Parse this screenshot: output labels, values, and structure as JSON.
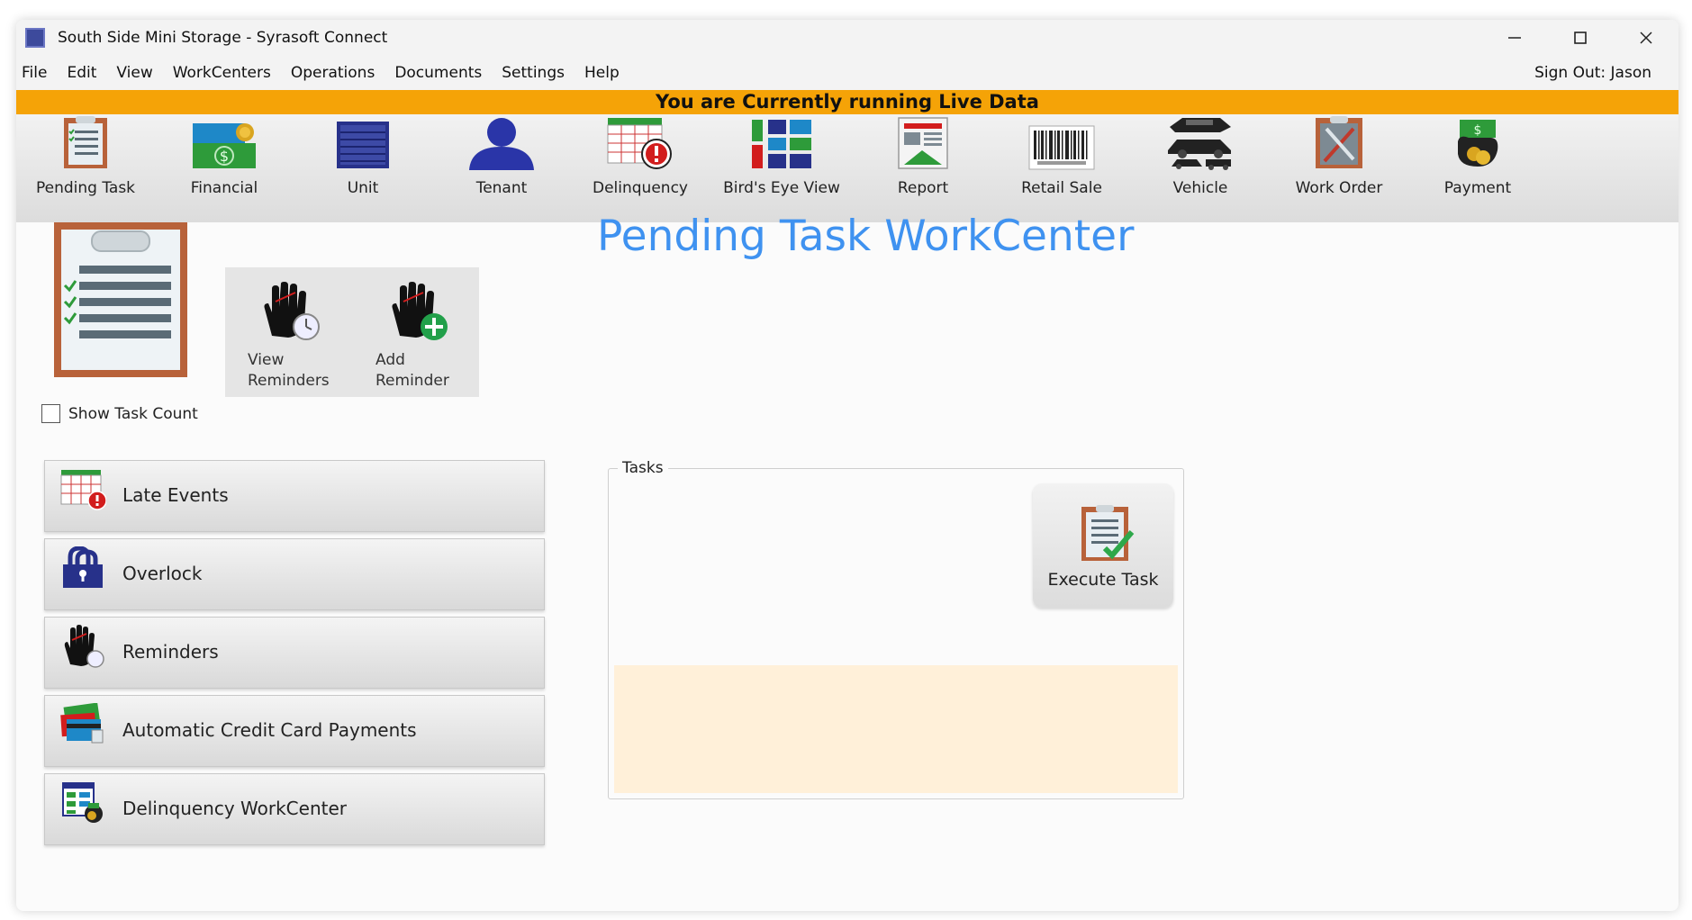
{
  "window": {
    "title": "South Side Mini Storage - Syrasoft Connect",
    "controls": {
      "minimize": "—",
      "maximize": "☐",
      "close": "✕"
    }
  },
  "menu": {
    "items": [
      "File",
      "Edit",
      "View",
      "WorkCenters",
      "Operations",
      "Documents",
      "Settings",
      "Help"
    ],
    "sign_out": "Sign Out: Jason"
  },
  "banner": {
    "text": "You are Currently running Live Data",
    "color": "#f5a307"
  },
  "toolbar": {
    "items": [
      {
        "label": "Pending Task",
        "icon": "clipboard-icon"
      },
      {
        "label": "Financial",
        "icon": "money-icon"
      },
      {
        "label": "Unit",
        "icon": "storage-unit-icon"
      },
      {
        "label": "Tenant",
        "icon": "person-icon"
      },
      {
        "label": "Delinquency",
        "icon": "calendar-alert-icon"
      },
      {
        "label": "Bird's Eye View",
        "icon": "map-grid-icon"
      },
      {
        "label": "Report",
        "icon": "report-icon"
      },
      {
        "label": "Retail Sale",
        "icon": "barcode-icon"
      },
      {
        "label": "Vehicle",
        "icon": "vehicle-icon"
      },
      {
        "label": "Work Order",
        "icon": "tools-icon"
      },
      {
        "label": "Payment",
        "icon": "payment-icon"
      }
    ]
  },
  "page": {
    "title": "Pending Task WorkCenter",
    "title_color": "#3f92f0",
    "show_task_count": {
      "label": "Show Task Count",
      "checked": false
    }
  },
  "reminders": {
    "view_line1": "View",
    "view_line2": "Reminders",
    "add_line1": "Add",
    "add_line2": "Reminder"
  },
  "side_buttons": [
    {
      "label": "Late Events",
      "icon": "late-events-icon"
    },
    {
      "label": "Overlock",
      "icon": "lock-icon"
    },
    {
      "label": "Reminders",
      "icon": "hand-clock-icon"
    },
    {
      "label": "Automatic Credit Card Payments",
      "icon": "credit-card-icon"
    },
    {
      "label": "Delinquency WorkCenter",
      "icon": "delinquency-icon"
    }
  ],
  "tasks": {
    "legend": "Tasks",
    "execute_label": "Execute Task",
    "area_color": "#fff0d9"
  }
}
